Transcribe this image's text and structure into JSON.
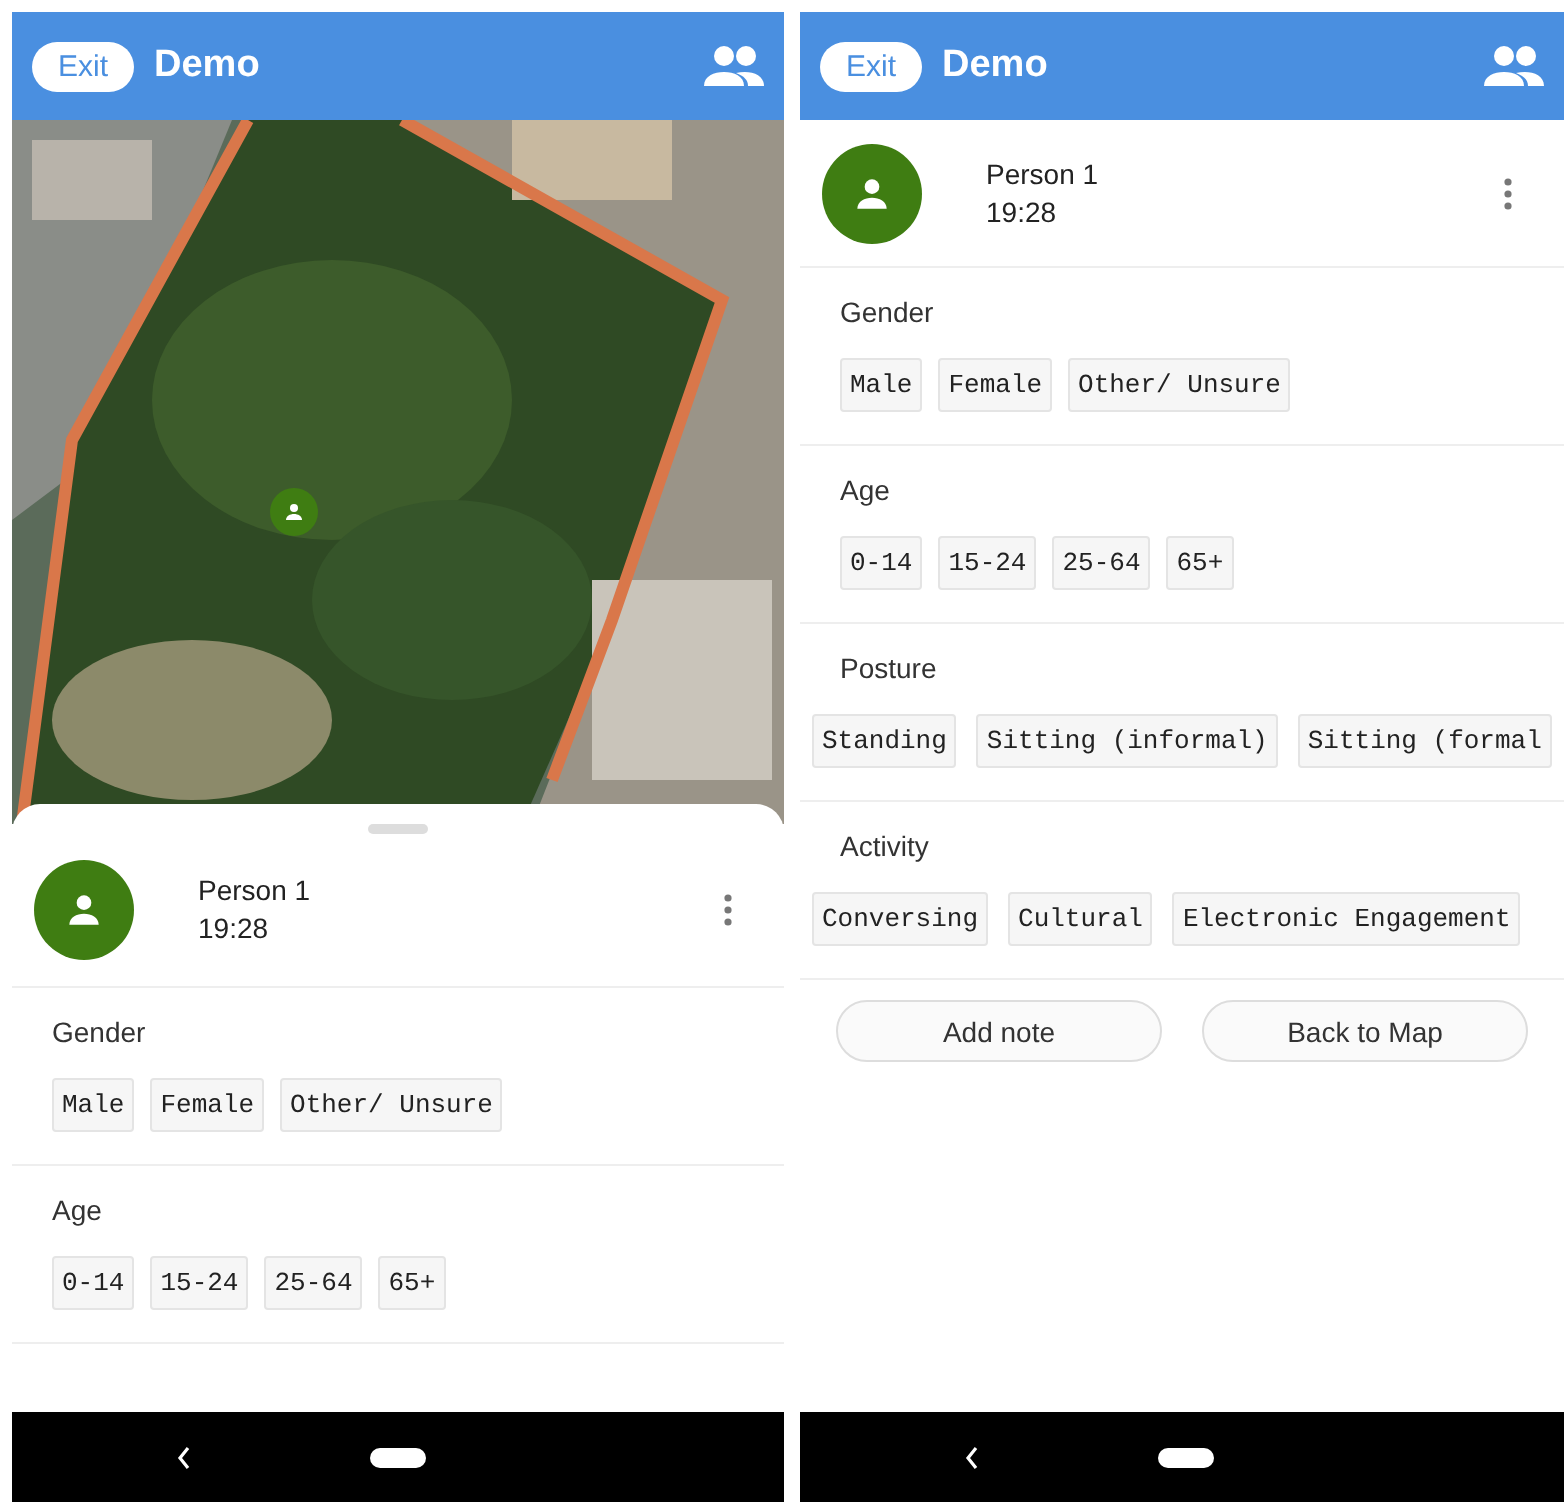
{
  "screens": [
    {
      "kind": "map",
      "app_bar": {
        "exit": "Exit",
        "title": "Demo"
      },
      "person": {
        "name": "Person 1",
        "time": "19:28"
      },
      "sections": [
        {
          "kind": "fixed",
          "label": "Gender",
          "options": [
            "Male",
            "Female",
            "Other/ Unsure"
          ]
        },
        {
          "kind": "fixed",
          "label": "Age",
          "options": [
            "0-14",
            "15-24",
            "25-64",
            "65+"
          ]
        }
      ]
    },
    {
      "kind": "detail",
      "app_bar": {
        "exit": "Exit",
        "title": "Demo"
      },
      "person": {
        "name": "Person 1",
        "time": "19:28"
      },
      "sections": [
        {
          "kind": "fixed",
          "label": "Gender",
          "options": [
            "Male",
            "Female",
            "Other/ Unsure"
          ]
        },
        {
          "kind": "fixed",
          "label": "Age",
          "options": [
            "0-14",
            "15-24",
            "25-64",
            "65+"
          ]
        },
        {
          "kind": "scroll",
          "label": "Posture",
          "options": [
            "Standing",
            "Sitting (informal)",
            "Sitting (formal"
          ]
        },
        {
          "kind": "scroll",
          "label": "Activity",
          "options": [
            "Conversing",
            "Cultural",
            "Electronic Engagement"
          ]
        }
      ],
      "actions": [
        "Add note",
        "Back to Map"
      ]
    }
  ]
}
